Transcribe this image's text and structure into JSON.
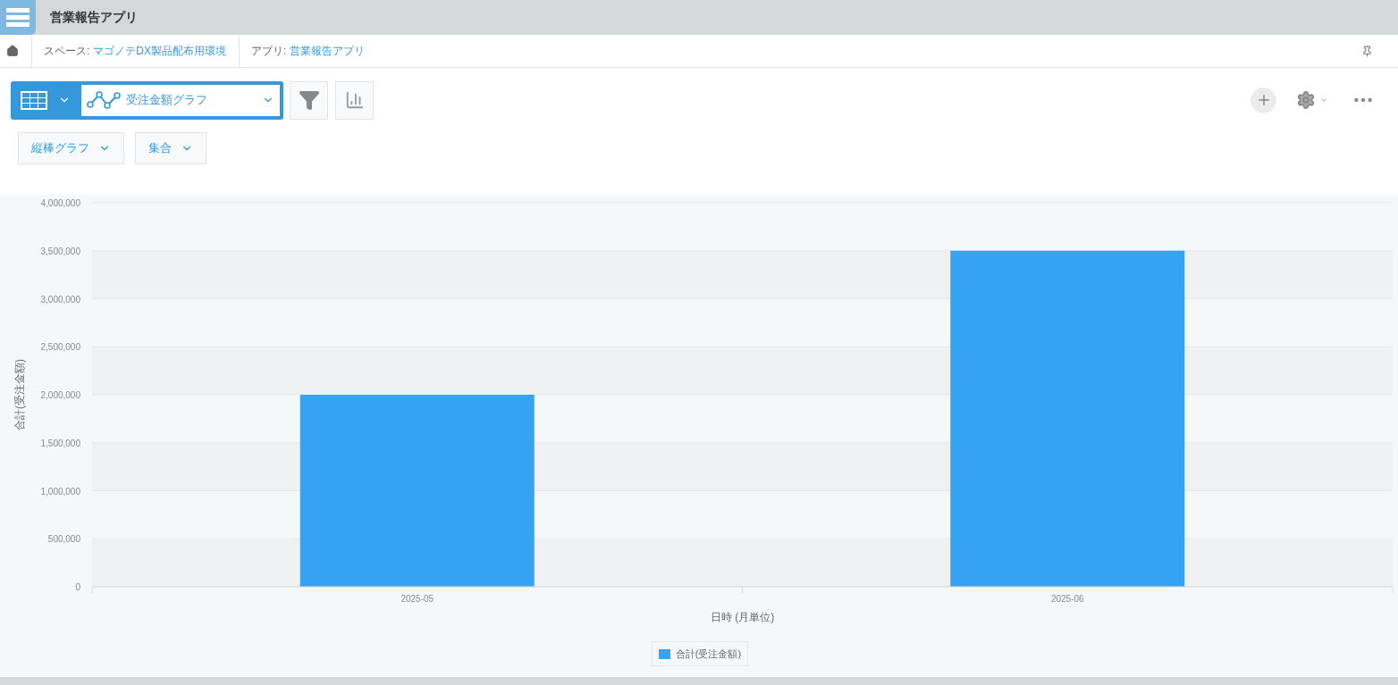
{
  "header": {
    "title": "営業報告アプリ"
  },
  "breadcrumb": [
    {
      "label": "スペース:",
      "link": "マゴノテDX製品配布用環境"
    },
    {
      "label": "アプリ:",
      "link": "営業報告アプリ"
    }
  ],
  "view_selector": {
    "label": "受注金額グラフ"
  },
  "chart_options": [
    {
      "label": "縦棒グラフ"
    },
    {
      "label": "集合"
    }
  ],
  "chart_data": {
    "type": "bar",
    "xlabel": "日時 (月単位)",
    "ylabel": "合計(受注金額)",
    "categories": [
      "2025-05",
      "2025-06"
    ],
    "series": [
      {
        "name": "合計(受注金額)",
        "color": "#36a2f2",
        "values": [
          2000000,
          3500000
        ]
      }
    ],
    "ylim": [
      0,
      4000000
    ],
    "grid": true,
    "yticks": [
      {
        "value": 0,
        "label": "0"
      },
      {
        "value": 500000,
        "label": "500,000"
      },
      {
        "value": 1000000,
        "label": "1,000,000"
      },
      {
        "value": 1500000,
        "label": "1,500,000"
      },
      {
        "value": 2000000,
        "label": "2,000,000"
      },
      {
        "value": 2500000,
        "label": "2,500,000"
      },
      {
        "value": 3000000,
        "label": "3,000,000"
      },
      {
        "value": 3500000,
        "label": "3,500,000"
      },
      {
        "value": 4000000,
        "label": "4,000,000"
      }
    ]
  }
}
